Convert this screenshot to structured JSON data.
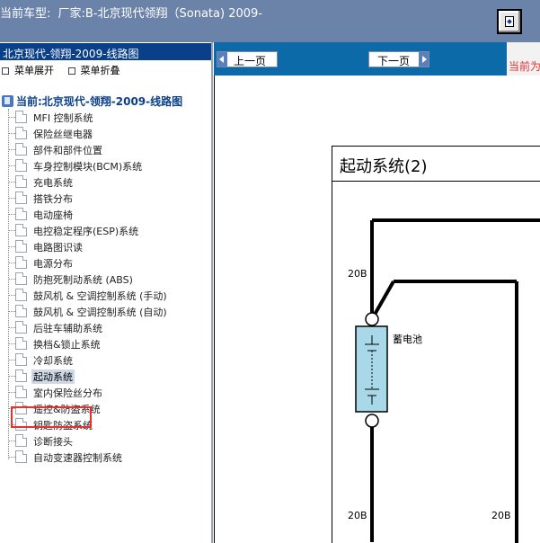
{
  "header": {
    "title_prefix": "当前车型:",
    "title_text": "厂家:B-北京现代领翔（Sonata) 2009-",
    "corner_button_icon": "window-restore-icon"
  },
  "sidebar": {
    "heading": "北京现代-领翔-2009-线路图",
    "expand_label": "菜单展开",
    "collapse_label": "菜单折叠",
    "current_label": "当前:北京现代-领翔-2009-线路图",
    "items": [
      {
        "label": "MFI 控制系统"
      },
      {
        "label": "保险丝继电器"
      },
      {
        "label": "部件和部件位置"
      },
      {
        "label": "车身控制模块(BCM)系统"
      },
      {
        "label": "充电系统"
      },
      {
        "label": "搭铁分布"
      },
      {
        "label": "电动座椅"
      },
      {
        "label": "电控稳定程序(ESP)系统"
      },
      {
        "label": "电路图识读"
      },
      {
        "label": "电源分布"
      },
      {
        "label": "防抱死制动系统 (ABS)"
      },
      {
        "label": "鼓风机 & 空调控制系统 (手动)"
      },
      {
        "label": "鼓风机 & 空调控制系统 (自动)"
      },
      {
        "label": "后驻车辅助系统"
      },
      {
        "label": "换档&锁止系统"
      },
      {
        "label": "冷却系统"
      },
      {
        "label": "起动系统",
        "selected": true
      },
      {
        "label": "室内保险丝分布"
      },
      {
        "label": "遥控&防盗系统"
      },
      {
        "label": "钥匙防盗系统"
      },
      {
        "label": "诊断接头"
      },
      {
        "label": "自动变速器控制系统"
      }
    ]
  },
  "nav": {
    "prev_label": "上一页",
    "next_label": "下一页",
    "current_position": "当前为"
  },
  "diagram": {
    "title": "起动系统(2)",
    "wire_top_left": "20B",
    "battery_label": "蓄电池",
    "wire_bottom_left": "20B",
    "wire_bottom_right": "20B"
  },
  "colors": {
    "header_bg": "#6b83a8",
    "sidebar_heading_bg": "#0a3f8a",
    "nav_bg": "#0d6aa8",
    "highlight_border": "#e8312f",
    "battery_fill": "#a9d8e8"
  }
}
